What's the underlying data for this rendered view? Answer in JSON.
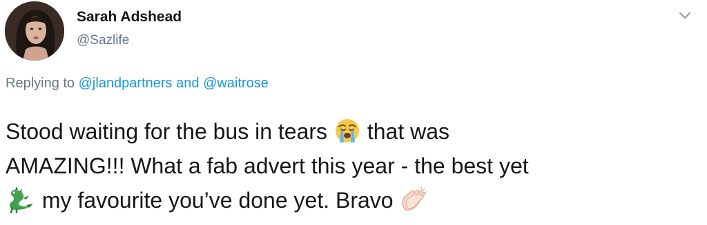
{
  "tweet": {
    "author": {
      "display_name": "Sarah Adshead",
      "handle": "@Sazlife"
    },
    "reply_context": {
      "prefix": "Replying to",
      "mention_1": "@jlandpartners",
      "conjunction": "and",
      "mention_2": "@waitrose"
    },
    "text": {
      "line1_part1": "Stood waiting for the bus in tears",
      "line1_part2": "that was",
      "line2": "AMAZING!!! What a fab advert this year - the best yet",
      "line3_part1": "my favourite you’ve done yet. Bravo"
    },
    "icons": {
      "emoji_1": "loudly-crying-face-emoji",
      "emoji_2": "dragon-emoji",
      "emoji_3": "clapping-hands-emoji",
      "menu": "chevron-down-icon"
    },
    "colors": {
      "mention": "#1b95e0",
      "secondary_text": "#657786",
      "primary_text": "#14171a"
    }
  }
}
